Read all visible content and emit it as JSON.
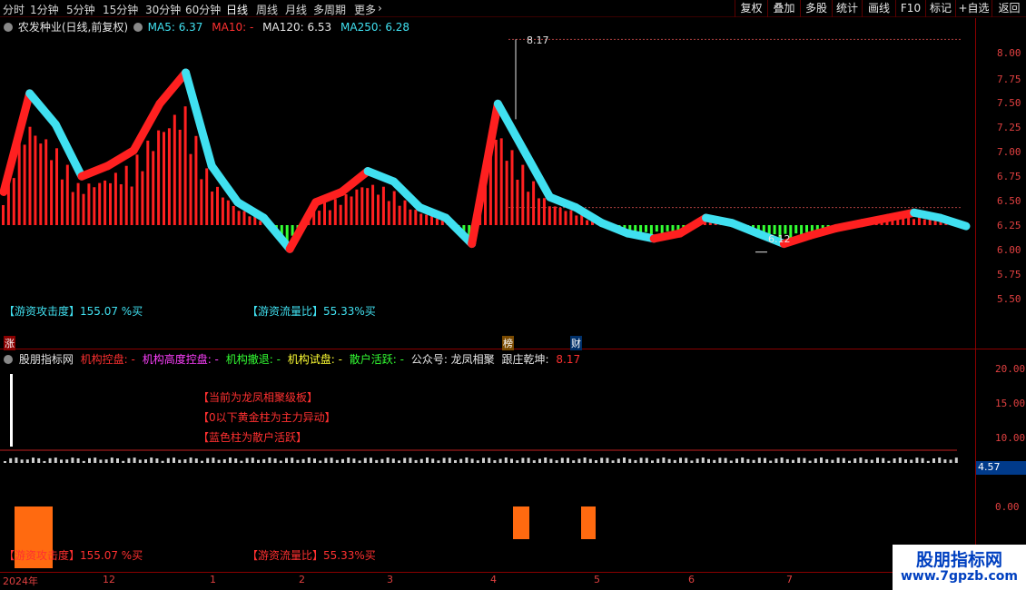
{
  "toolbar": {
    "periods": [
      "分时",
      "1分钟",
      "5分钟",
      "15分钟",
      "30分钟",
      "60分钟",
      "日线",
      "周线",
      "月线",
      "多周期",
      "更多"
    ],
    "active_period": "日线",
    "more_arrow": "›",
    "buttons": [
      "复权",
      "叠加",
      "多股",
      "统计",
      "画线",
      "F10",
      "标记",
      "+自选",
      "返回"
    ]
  },
  "main_chart": {
    "title": "农发种业(日线,前复权)",
    "ma5_label": "MA5: 6.37",
    "ma10_label": "MA10: -",
    "ma120_label": "MA120: 6.53",
    "ma250_label": "MA250: 6.28",
    "high_marker": "8.17",
    "low_marker": "6.12",
    "left_annotation": "【游资攻击度】155.07 %买",
    "right_annotation": "【游资流量比】55.33%买",
    "event_markers": [
      "涨",
      "榜",
      "财"
    ]
  },
  "sub_chart": {
    "indicator_name": "股朋指标网",
    "items": [
      {
        "label": "机构控盘: -",
        "color": "#ff3030"
      },
      {
        "label": "机构高度控盘: -",
        "color": "#ff40ff"
      },
      {
        "label": "机构撤退: -",
        "color": "#33ff33"
      },
      {
        "label": "机构试盘: -",
        "color": "#ffff33"
      },
      {
        "label": "散户活跃: -",
        "color": "#33ff33"
      },
      {
        "label": "公众号: 龙凤相聚",
        "color": "#e6e6e6"
      },
      {
        "label": "跟庄乾坤:",
        "color": "#e6e6e6"
      },
      {
        "label": "8.17",
        "color": "#ff3030"
      }
    ],
    "notes": [
      "【当前为龙凤相聚级板】",
      "【0以下黄金柱为主力异动】",
      "【蓝色柱为散户活跃】"
    ],
    "left_annotation": "【游资攻击度】155.07 %买",
    "right_annotation": "【游资流量比】55.33%买",
    "current_value": "4.57"
  },
  "price_axis": [
    "8.00",
    "7.75",
    "7.50",
    "7.25",
    "7.00",
    "6.75",
    "6.50",
    "6.25",
    "6.00",
    "5.75",
    "5.50"
  ],
  "sub_axis": [
    "20.00",
    "15.00",
    "10.00",
    "0.00"
  ],
  "date_axis": [
    "2024年",
    "12",
    "1",
    "2",
    "3",
    "4",
    "5",
    "6",
    "7"
  ],
  "watermark": {
    "title": "股朋指标网",
    "url": "www.7gpzb.com"
  },
  "colors": {
    "up": "#ff2020",
    "down": "#33ff33",
    "ma_line": "#40e0f0",
    "frame": "#8a0000",
    "orange": "#ff6a10"
  },
  "chart_data": {
    "type": "line",
    "title": "农发种业(日线,前复权)",
    "x": [
      "2024年",
      "12",
      "1",
      "2",
      "3",
      "4",
      "5",
      "6",
      "7"
    ],
    "ylim": [
      5.4,
      8.2
    ],
    "series": [
      {
        "name": "MA5",
        "values": [
          6.7,
          7.65,
          7.35,
          6.85,
          6.95,
          7.1,
          7.55,
          7.85,
          6.95,
          6.6,
          6.45,
          6.15,
          6.6,
          6.7,
          6.9,
          6.8,
          6.55,
          6.45,
          6.2,
          7.55,
          7.1,
          6.65,
          6.55,
          6.4,
          6.3,
          6.25,
          6.3,
          6.45,
          6.4,
          6.3,
          6.2,
          6.28,
          6.35,
          6.4,
          6.45,
          6.5,
          6.45,
          6.37
        ]
      }
    ],
    "high": 8.17,
    "low": 6.12
  }
}
